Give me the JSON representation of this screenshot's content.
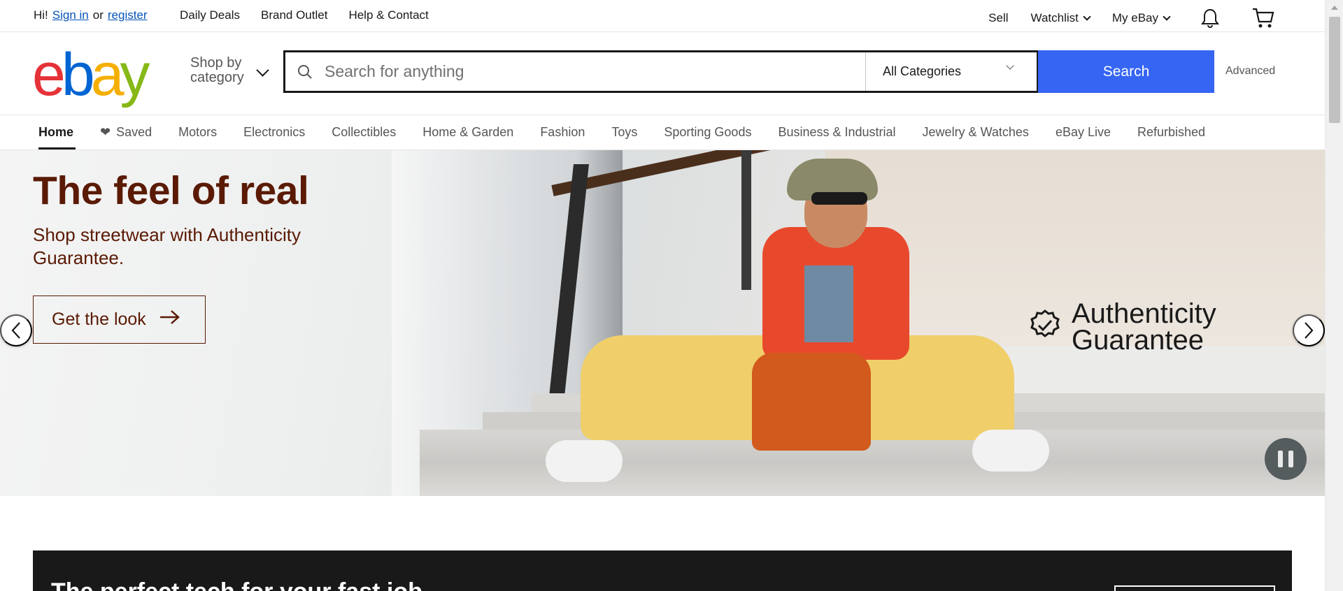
{
  "topbar": {
    "greeting": "Hi!",
    "sign_in": "Sign in",
    "or": "or",
    "register": "register",
    "links": [
      "Daily Deals",
      "Brand Outlet",
      "Help & Contact"
    ],
    "sell": "Sell",
    "watchlist": "Watchlist",
    "my_ebay": "My eBay",
    "icons": [
      "bell-icon",
      "cart-icon"
    ]
  },
  "header": {
    "logo": [
      "e",
      "b",
      "a",
      "y"
    ],
    "logo_colors": [
      "#e53238",
      "#0064d2",
      "#f5af02",
      "#86b817"
    ],
    "shop_by_line1": "Shop by",
    "shop_by_line2": "category",
    "search_placeholder": "Search for anything",
    "category_selected": "All Categories",
    "search_button": "Search",
    "advanced": "Advanced"
  },
  "nav": {
    "items": [
      "Home",
      "Saved",
      "Motors",
      "Electronics",
      "Collectibles",
      "Home & Garden",
      "Fashion",
      "Toys",
      "Sporting Goods",
      "Business & Industrial",
      "Jewelry & Watches",
      "eBay Live",
      "Refurbished"
    ],
    "active": "Home"
  },
  "hero": {
    "title": "The feel of real",
    "subtitle": "Shop streetwear with Authenticity Guarantee.",
    "cta": "Get the look",
    "badge_line1": "Authenticity",
    "badge_line2": "Guarantee",
    "accent_color": "#5a1a04"
  },
  "promo": {
    "title": "The perfect tech for your fast job"
  }
}
